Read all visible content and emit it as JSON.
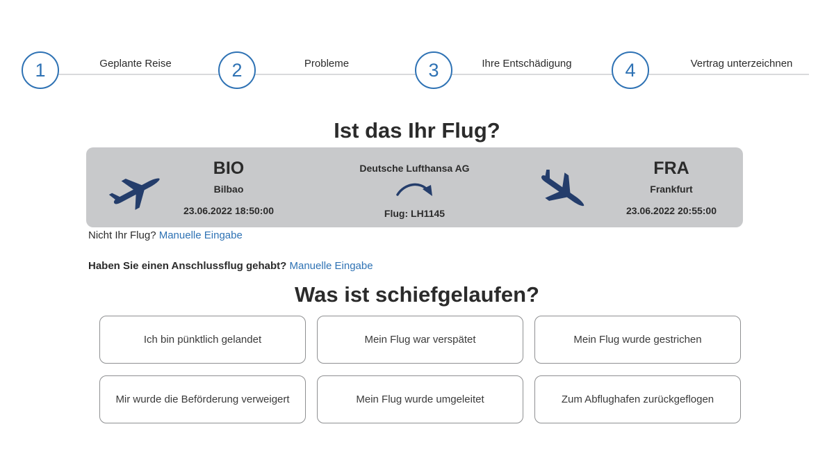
{
  "stepper": {
    "steps": [
      {
        "number": "1",
        "label": "Geplante Reise"
      },
      {
        "number": "2",
        "label": "Probleme"
      },
      {
        "number": "3",
        "label": "Ihre Entschädigung"
      },
      {
        "number": "4",
        "label": "Vertrag unterzeichnen"
      }
    ],
    "accent_color": "#2e72b4"
  },
  "flight_section": {
    "title": "Ist das Ihr Flug?",
    "card": {
      "departure": {
        "code": "BIO",
        "city": "Bilbao",
        "datetime": "23.06.2022 18:50:00"
      },
      "arrival": {
        "code": "FRA",
        "city": "Frankfurt",
        "datetime": "23.06.2022 20:55:00"
      },
      "airline": "Deutsche Lufthansa AG",
      "flight_label": "Flug: LH1145",
      "icons": {
        "departure": "plane-takeoff-icon",
        "arrival": "plane-landing-icon",
        "route": "curved-arrow-icon"
      },
      "icon_color": "#243d6b",
      "background_color": "#c8c9cb"
    },
    "not_your_flight": {
      "question": "Nicht Ihr Flug?",
      "link": "Manuelle Eingabe"
    },
    "connecting_flight": {
      "question": "Haben Sie einen Anschlussflug gehabt?",
      "link": "Manuelle Eingabe"
    }
  },
  "problem_section": {
    "title": "Was ist schiefgelaufen?",
    "options": [
      "Ich bin pünktlich gelandet",
      "Mein Flug war verspätet",
      "Mein Flug wurde gestrichen",
      "Mir wurde die Beförderung verweigert",
      "Mein Flug wurde umgeleitet",
      "Zum Abflughafen zurückgeflogen"
    ]
  }
}
